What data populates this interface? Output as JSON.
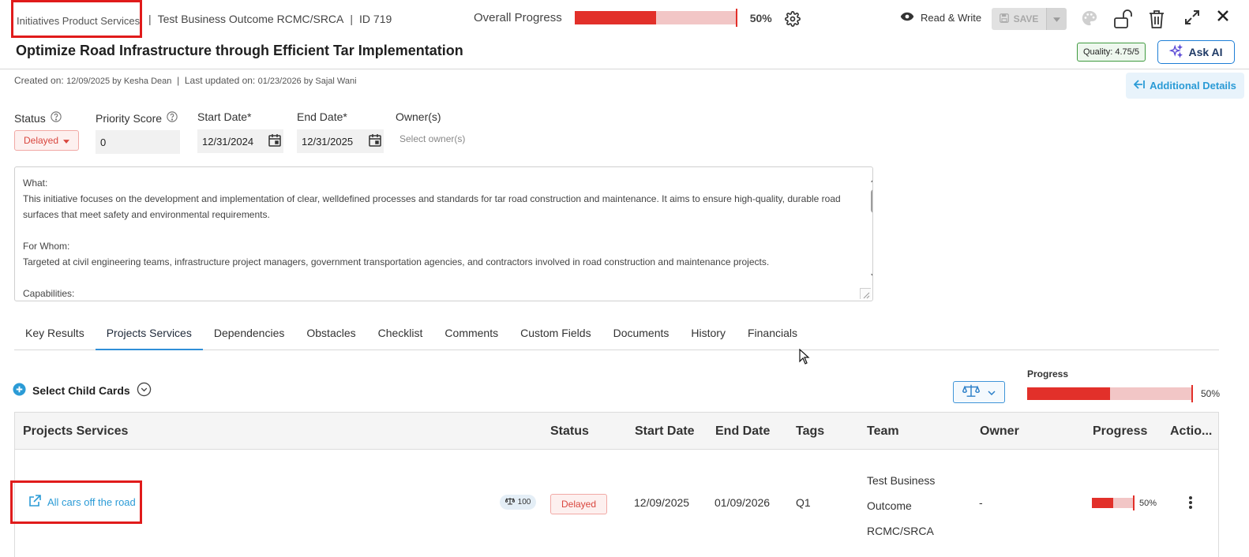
{
  "breadcrumb": {
    "first": "Initiatives Product Services",
    "second": "Test Business Outcome RCMC/SRCA",
    "id": "ID 719"
  },
  "overall": {
    "label": "Overall Progress",
    "value_text": "50%",
    "progress_fraction": 0.5
  },
  "toolbar": {
    "mode_label": "Read & Write",
    "save_label": "SAVE"
  },
  "header": {
    "title": "Optimize Road Infrastructure through Efficient Tar Implementation",
    "quality": "Quality: 4.75/5",
    "ask_ai": "Ask AI"
  },
  "meta": {
    "created_label": "Created on:",
    "created_value": "12/09/2025 by Kesha Dean",
    "sep": "|",
    "updated_label": "Last updated on:",
    "updated_value": "01/23/2026 by Sajal Wani",
    "additional_details": "Additional Details"
  },
  "form": {
    "status_label": "Status",
    "status_value": "Delayed",
    "priority_label": "Priority Score",
    "priority_value": "0",
    "start_label": "Start Date*",
    "start_value": "12/31/2024",
    "end_label": "End Date*",
    "end_value": "12/31/2025",
    "owners_label": "Owner(s)",
    "owners_placeholder": "Select owner(s)"
  },
  "description": "What:\nThis initiative focuses on the development and implementation of clear, welldefined processes and standards for tar road construction and maintenance. It aims to ensure high-quality, durable road surfaces that meet safety and environmental requirements.\n\nFor Whom:\nTargeted at civil engineering teams, infrastructure project managers, government transportation agencies, and contractors involved in road construction and maintenance projects.\n\nCapabilities:",
  "tabs": [
    "Key Results",
    "Projects Services",
    "Dependencies",
    "Obstacles",
    "Checklist",
    "Comments",
    "Custom Fields",
    "Documents",
    "History",
    "Financials"
  ],
  "child_cards": {
    "select_label": "Select Child Cards",
    "progress_label": "Progress",
    "progress_text": "50%",
    "progress_fraction": 0.5
  },
  "table": {
    "headers": {
      "name": "Projects Services",
      "status": "Status",
      "start": "Start Date",
      "end": "End Date",
      "tags": "Tags",
      "team": "Team",
      "owner": "Owner",
      "progress": "Progress",
      "actions": "Actio..."
    },
    "rows": [
      {
        "name": "All cars off the road",
        "weight": "100",
        "status": "Delayed",
        "start": "12/09/2025",
        "end": "01/09/2026",
        "tags": "Q1",
        "team": "Test Business Outcome RCMC/SRCA",
        "owner": "-",
        "progress_text": "50%",
        "progress_fraction": 0.5
      }
    ]
  },
  "colors": {
    "accent": "#2b9bd6",
    "progress_fill": "#e2302a",
    "progress_track": "#f2c6c6",
    "delayed": "#d9463e",
    "highlight_box": "#e01b1b"
  }
}
